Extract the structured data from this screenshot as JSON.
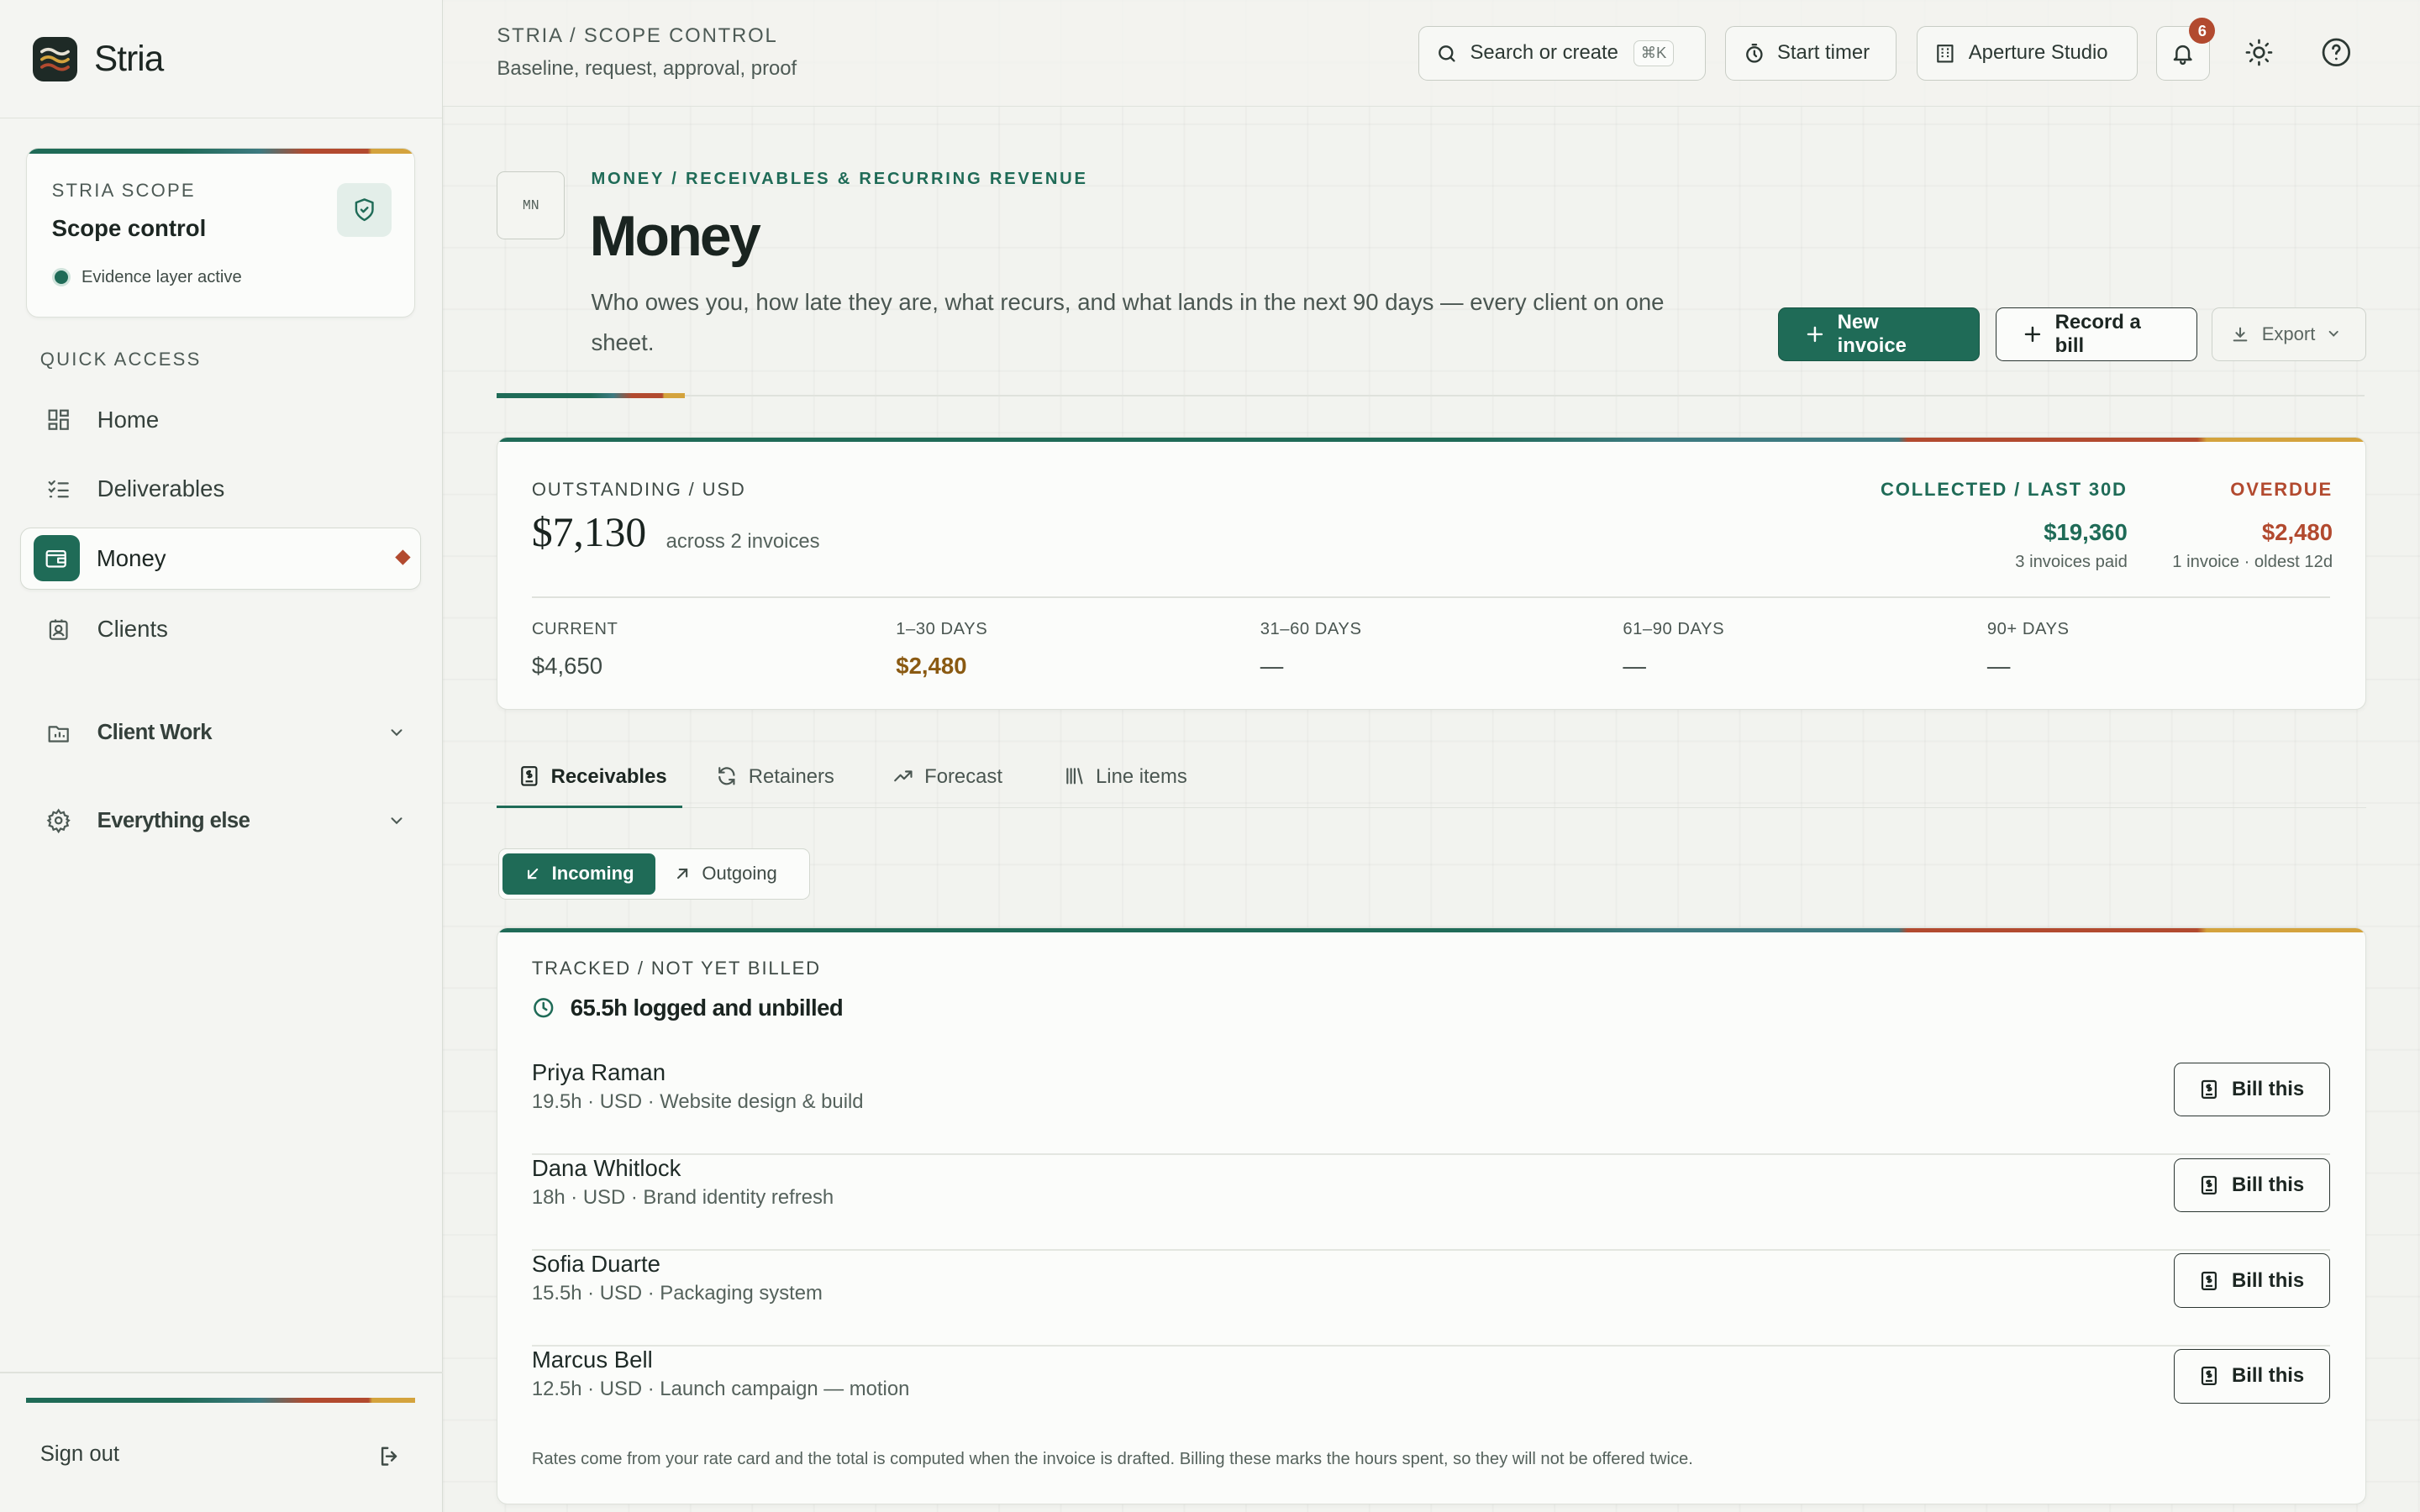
{
  "brand": {
    "name": "Stria"
  },
  "scope_card": {
    "kicker": "STRIA SCOPE",
    "title": "Scope control",
    "status": "Evidence layer active"
  },
  "sidebar": {
    "section_label": "QUICK ACCESS",
    "items": [
      {
        "label": "Home",
        "icon": "grid-icon"
      },
      {
        "label": "Deliverables",
        "icon": "checklist-icon"
      },
      {
        "label": "Money",
        "icon": "wallet-icon",
        "active": true
      },
      {
        "label": "Clients",
        "icon": "contact-icon"
      }
    ],
    "groups": [
      {
        "label": "Client Work",
        "icon": "folder-chart-icon"
      },
      {
        "label": "Everything else",
        "icon": "gear-icon"
      }
    ],
    "signout": "Sign out"
  },
  "topbar": {
    "crumb": "STRIA / SCOPE CONTROL",
    "crumb_sub": "Baseline, request, approval, proof",
    "search_label": "Search or create",
    "search_kbd": "⌘K",
    "timer_label": "Start timer",
    "workspace_label": "Aperture Studio",
    "notifications_count": "6"
  },
  "page": {
    "badge": "MN",
    "kicker": "MONEY / RECEIVABLES & RECURRING REVENUE",
    "title": "Money",
    "description": "Who owes you, how late they are, what recurs, and what lands in the next 90 days — every client on one sheet.",
    "actions": {
      "new_invoice": "New invoice",
      "record_bill": "Record a bill",
      "export": "Export"
    }
  },
  "summary": {
    "label": "OUTSTANDING / USD",
    "amount": "$7,130",
    "across": "across 2 invoices",
    "collected": {
      "label": "COLLECTED / LAST 30D",
      "value": "$19,360",
      "sub": "3 invoices paid"
    },
    "overdue": {
      "label": "OVERDUE",
      "value": "$2,480",
      "sub": "1 invoice · oldest 12d"
    },
    "buckets": [
      {
        "label": "CURRENT",
        "value": "$4,650"
      },
      {
        "label": "1–30 DAYS",
        "value": "$2,480"
      },
      {
        "label": "31–60 DAYS",
        "value": "—"
      },
      {
        "label": "61–90 DAYS",
        "value": "—"
      },
      {
        "label": "90+ DAYS",
        "value": "—"
      }
    ]
  },
  "tabs": [
    {
      "label": "Receivables",
      "icon": "receipt-icon",
      "active": true
    },
    {
      "label": "Retainers",
      "icon": "refresh-icon"
    },
    {
      "label": "Forecast",
      "icon": "trending-up-icon"
    },
    {
      "label": "Line items",
      "icon": "library-icon"
    }
  ],
  "segment": {
    "incoming": "Incoming",
    "outgoing": "Outgoing"
  },
  "tracked": {
    "label": "TRACKED / NOT YET BILLED",
    "headline": "65.5h logged and unbilled",
    "bill_label": "Bill this",
    "rows": [
      {
        "name": "Priya Raman",
        "meta": "19.5h · USD · Website design & build"
      },
      {
        "name": "Dana Whitlock",
        "meta": "18h · USD · Brand identity refresh"
      },
      {
        "name": "Sofia Duarte",
        "meta": "15.5h · USD · Packaging system"
      },
      {
        "name": "Marcus Bell",
        "meta": "12.5h · USD · Launch campaign — motion"
      }
    ],
    "note": "Rates come from your rate card and the total is computed when the invoice is drafted. Billing these marks the hours spent, so they will not be offered twice."
  },
  "colors": {
    "accent": "#1f6b57",
    "danger": "#b24a2f",
    "warning": "#d4a33d",
    "amber_text": "#8a5a12"
  }
}
